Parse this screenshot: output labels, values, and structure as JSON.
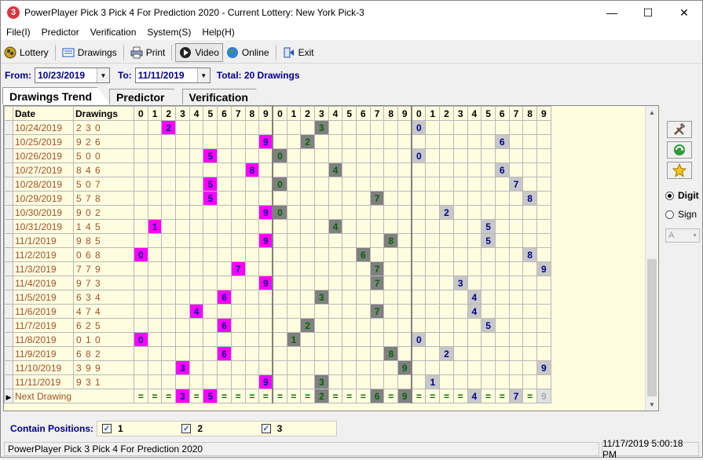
{
  "window": {
    "app_icon_glyph": "3",
    "title": "PowerPlayer Pick 3 Pick 4 For Prediction 2020 - Current Lottery: New York Pick-3",
    "controls": [
      "—",
      "☐",
      "✕"
    ]
  },
  "menu": [
    "File(I)",
    "Predictor",
    "Verification",
    "System(S)",
    "Help(H)"
  ],
  "toolbar": {
    "lottery": "Lottery",
    "drawings": "Drawings",
    "print": "Print",
    "video": "Video",
    "online": "Online",
    "exit": "Exit"
  },
  "daterow": {
    "from_label": "From:",
    "from_value": "10/23/2019",
    "to_label": "To:",
    "to_value": "11/11/2019",
    "total": "Total: 20 Drawings"
  },
  "tabs": [
    "Drawings Trend",
    "Predictor",
    "Verification"
  ],
  "grid": {
    "col_date": "Date",
    "col_drawings": "Drawings",
    "digit_headers": [
      "0",
      "1",
      "2",
      "3",
      "4",
      "5",
      "6",
      "7",
      "8",
      "9",
      "0",
      "1",
      "2",
      "3",
      "4",
      "5",
      "6",
      "7",
      "8",
      "9",
      "0",
      "1",
      "2",
      "3",
      "4",
      "5",
      "6",
      "7",
      "8",
      "9"
    ],
    "rows": [
      {
        "date": "10/24/2019",
        "draw": "2 3 0",
        "d": [
          2,
          3,
          0
        ]
      },
      {
        "date": "10/25/2019",
        "draw": "9 2 6",
        "d": [
          9,
          2,
          6
        ]
      },
      {
        "date": "10/26/2019",
        "draw": "5 0 0",
        "d": [
          5,
          0,
          0
        ]
      },
      {
        "date": "10/27/2019",
        "draw": "8 4 6",
        "d": [
          8,
          4,
          6
        ]
      },
      {
        "date": "10/28/2019",
        "draw": "5 0 7",
        "d": [
          5,
          0,
          7
        ]
      },
      {
        "date": "10/29/2019",
        "draw": "5 7 8",
        "d": [
          5,
          7,
          8
        ]
      },
      {
        "date": "10/30/2019",
        "draw": "9 0 2",
        "d": [
          9,
          0,
          2
        ]
      },
      {
        "date": "10/31/2019",
        "draw": "1 4 5",
        "d": [
          1,
          4,
          5
        ]
      },
      {
        "date": "11/1/2019",
        "draw": "9 8 5",
        "d": [
          9,
          8,
          5
        ]
      },
      {
        "date": "11/2/2019",
        "draw": "0 6 8",
        "d": [
          0,
          6,
          8
        ]
      },
      {
        "date": "11/3/2019",
        "draw": "7 7 9",
        "d": [
          7,
          7,
          9
        ]
      },
      {
        "date": "11/4/2019",
        "draw": "9 7 3",
        "d": [
          9,
          7,
          3
        ]
      },
      {
        "date": "11/5/2019",
        "draw": "6 3 4",
        "d": [
          6,
          3,
          4
        ]
      },
      {
        "date": "11/6/2019",
        "draw": "4 7 4",
        "d": [
          4,
          7,
          4
        ]
      },
      {
        "date": "11/7/2019",
        "draw": "6 2 5",
        "d": [
          6,
          2,
          5
        ]
      },
      {
        "date": "11/8/2019",
        "draw": "0 1 0",
        "d": [
          0,
          1,
          0
        ]
      },
      {
        "date": "11/9/2019",
        "draw": "6 8 2",
        "d": [
          6,
          8,
          2
        ]
      },
      {
        "date": "11/10/2019",
        "draw": "3 9 9",
        "d": [
          3,
          9,
          9
        ]
      },
      {
        "date": "11/11/2019",
        "draw": "9 3 1",
        "d": [
          9,
          3,
          1
        ]
      }
    ],
    "next_label": "Next Drawing",
    "next_cells": [
      "=",
      "=",
      "=",
      "3",
      "=",
      "5",
      "=",
      "=",
      "=",
      "=",
      "=",
      "=",
      "=",
      "2",
      "=",
      "=",
      "=",
      "6",
      "=",
      "9",
      "=",
      "=",
      "=",
      "=",
      "4",
      "=",
      "=",
      "7",
      "=",
      "9"
    ],
    "next_highlight": {
      "3": 1,
      "5": 1,
      "13": 2,
      "17": 2,
      "19": 2,
      "24": 3,
      "27": 3,
      "29": 4
    }
  },
  "right_panel": {
    "digit_label": "Digit",
    "sign_label": "Sign",
    "sign_value": "A"
  },
  "positions": {
    "label": "Contain Positions:",
    "items": [
      {
        "label": "1",
        "checked": "✓"
      },
      {
        "label": "2",
        "checked": "✓"
      },
      {
        "label": "3",
        "checked": "✓"
      }
    ]
  },
  "status": {
    "left": "PowerPlayer Pick 3 Pick 4 For Prediction 2020",
    "right": "11/17/2019 5:00:18 PM"
  },
  "colors": {
    "pos1": "#ff00ff",
    "pos2": "#808080",
    "pos3": "#c8c8c8",
    "grid_bg": "#fffde0",
    "date_text": "#a0522d"
  }
}
